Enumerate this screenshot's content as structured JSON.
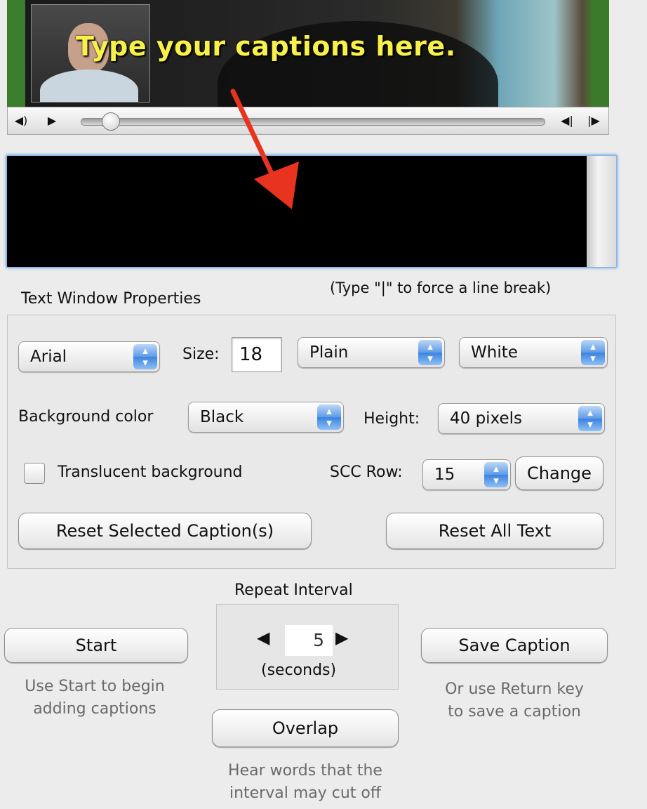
{
  "video": {
    "caption_overlay": "Type your captions here."
  },
  "transport": {
    "volume_icon": "◀)",
    "play_icon": "▶",
    "step_back_icon": "◀|",
    "step_forward_icon": "|▶"
  },
  "hint_line_break": "(Type  \"|\" to force a line break)",
  "properties": {
    "title": "Text Window Properties",
    "font_select": "Arial",
    "size_label": "Size:",
    "size_value": "18",
    "style_select": "Plain",
    "color_select": "White",
    "background_color_label": "Background color",
    "background_color_select": "Black",
    "height_label": "Height:",
    "height_select": "40 pixels",
    "translucent_label": "Translucent background",
    "scc_row_label": "SCC Row:",
    "scc_row_select": "15",
    "change_button": "Change",
    "reset_selected_button": "Reset Selected Caption(s)",
    "reset_all_button": "Reset All Text"
  },
  "controls": {
    "repeat_interval_label": "Repeat Interval",
    "interval_value": "5",
    "seconds_label": "(seconds)",
    "start_button": "Start",
    "start_note_line1": "Use Start to begin",
    "start_note_line2": "adding captions",
    "save_button": "Save Caption",
    "save_note_line1": "Or use Return key",
    "save_note_line2": "to save a caption",
    "overlap_button": "Overlap",
    "overlap_note_line1": "Hear words that the",
    "overlap_note_line2": "interval may cut off"
  }
}
